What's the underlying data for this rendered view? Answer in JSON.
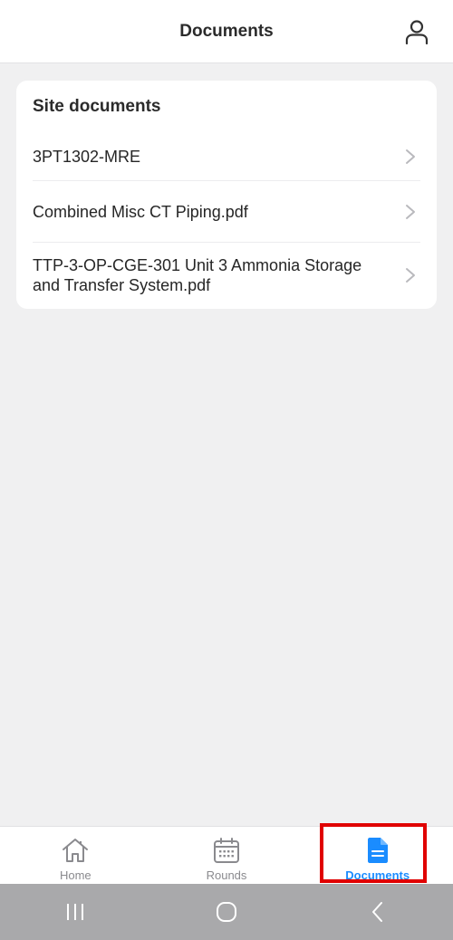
{
  "header": {
    "title": "Documents",
    "profile_icon": "person-icon"
  },
  "card": {
    "title": "Site documents",
    "documents": [
      {
        "label": "3PT1302-MRE"
      },
      {
        "label": "Combined Misc CT Piping.pdf"
      },
      {
        "label": "TTP-3-OP-CGE-301 Unit 3 Ammonia Storage and Transfer System.pdf"
      }
    ]
  },
  "tabbar": {
    "tabs": [
      {
        "label": "Home",
        "icon": "home-icon",
        "active": false
      },
      {
        "label": "Rounds",
        "icon": "calendar-icon",
        "active": false
      },
      {
        "label": "Documents",
        "icon": "document-icon",
        "active": true
      }
    ]
  },
  "colors": {
    "accent": "#1a8cff",
    "background": "#f0f0f1",
    "highlight": "#e00000",
    "system_nav": "#a9a9ab"
  },
  "system_nav": {
    "icons": [
      "recent-apps-icon",
      "home-circle-icon",
      "back-icon"
    ]
  }
}
